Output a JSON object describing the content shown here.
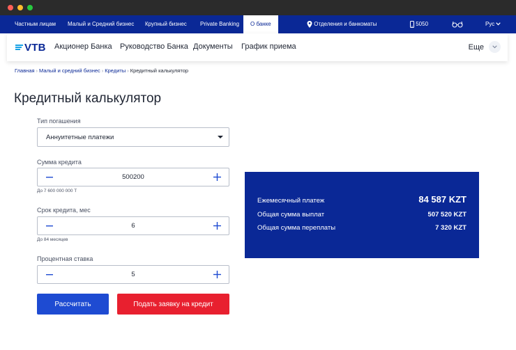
{
  "top_nav": {
    "items": [
      "Частным лицам",
      "Малый и Средний бизнес",
      "Крупный бизнес",
      "Private Banking",
      "О банке"
    ],
    "active": "О банке",
    "branches": "Отделения и банкоматы",
    "phone": "5050",
    "language": "Рус"
  },
  "main_nav": {
    "logo": "VTB",
    "links": [
      "Акционер Банка",
      "Руководство Банка",
      "Документы",
      "График приема"
    ],
    "more": "Еще"
  },
  "breadcrumb": {
    "items": [
      "Главная",
      "Малый и средний бизнес",
      "Кредиты"
    ],
    "current": "Кредитный калькулятор",
    "separator": "›"
  },
  "page_title": "Кредитный калькулятор",
  "form": {
    "repayment_type": {
      "label": "Тип погашения",
      "value": "Аннуитетные платежи"
    },
    "loan_amount": {
      "label": "Сумма кредита",
      "value": "500200",
      "hint": "До 7 600 000 000 Т"
    },
    "loan_term": {
      "label": "Срок кредита, мес",
      "value": "6",
      "hint": "До 84 месяцев"
    },
    "interest_rate": {
      "label": "Процентная ставка",
      "value": "5"
    },
    "calculate_label": "Рассчитать",
    "apply_label": "Подать заявку на кредит"
  },
  "result": {
    "monthly_label": "Ежемесячный платеж",
    "monthly_value": "84 587 KZT",
    "total_label": "Общая сумма выплат",
    "total_value": "507 520 KZT",
    "overpay_label": "Общая сумма переплаты",
    "overpay_value": "7 320 KZT"
  },
  "colors": {
    "brand_blue": "#0a2896",
    "button_blue": "#1e4bd2",
    "button_red": "#e8202f",
    "logo_accent": "#17a1e5"
  }
}
